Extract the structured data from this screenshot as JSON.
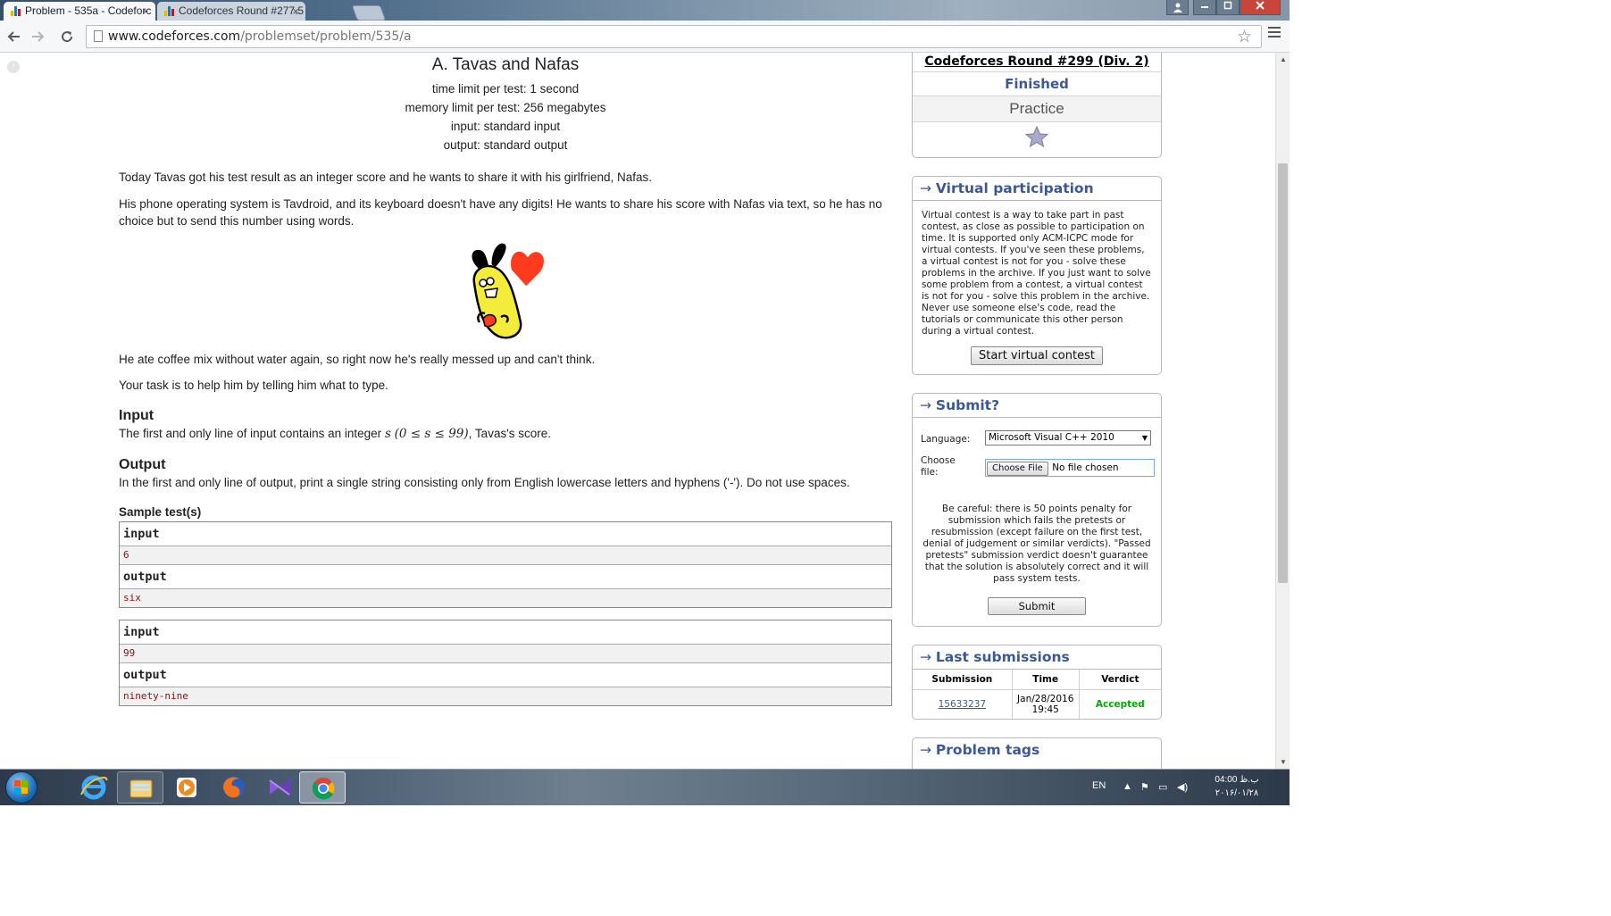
{
  "browser": {
    "tabs": [
      {
        "title": "Problem - 535a - Codeforc",
        "active": true
      },
      {
        "title": "Codeforces Round #277.5",
        "active": false
      }
    ],
    "url_host": "www.codeforces.com",
    "url_path": "/problemset/problem/535/a",
    "close_glyph": "×"
  },
  "problem": {
    "title": "A. Tavas and Nafas",
    "limits": [
      "time limit per test: 1 second",
      "memory limit per test: 256 megabytes",
      "input: standard input",
      "output: standard output"
    ],
    "statement": [
      "Today Tavas got his test result as an integer score and he wants to share it with his girlfriend, Nafas.",
      "His phone operating system is Tavdroid, and its keyboard doesn't have any digits! He wants to share his score with Nafas via text, so he has no choice but to send this number using words.",
      "He ate coffee mix without water again, so right now he's really messed up and can't think.",
      "Your task is to help him by telling him what to type."
    ],
    "input_title": "Input",
    "input_text_before": "The first and only line of input contains an integer ",
    "input_math_var": "s",
    "input_math_range": "(0 ≤ s ≤ 99)",
    "input_text_after": ", Tavas's score.",
    "output_title": "Output",
    "output_text": "In the first and only line of output, print a single string consisting only from English lowercase letters and hyphens ('-'). Do not use spaces.",
    "samples_title": "Sample test(s)",
    "samples": [
      {
        "input_label": "input",
        "input": "6",
        "output_label": "output",
        "output": "six"
      },
      {
        "input_label": "input",
        "input": "99",
        "output_label": "output",
        "output": "ninety-nine"
      }
    ]
  },
  "sidebar": {
    "contest_name": "Codeforces Round #299 (Div. 2)",
    "contest_status": "Finished",
    "contest_mode": "Practice",
    "virtual": {
      "title": "Virtual participation",
      "text": "Virtual contest is a way to take part in past contest, as close as possible to participation on time. It is supported only ACM-ICPC mode for virtual contests. If you've seen these problems, a virtual contest is not for you - solve these problems in the archive. If you just want to solve some problem from a contest, a virtual contest is not for you - solve this problem in the archive. Never use someone else's code, read the tutorials or communicate this other person during a virtual contest.",
      "button": "Start virtual contest"
    },
    "submit": {
      "title": "Submit?",
      "language_label": "Language:",
      "language_value": "Microsoft Visual C++ 2010",
      "file_label": "Choose file:",
      "file_button": "Choose File",
      "file_status": "No file chosen",
      "warning": "Be careful: there is 50 points penalty for submission which fails the pretests or resubmission (except failure on the first test, denial of judgement or similar verdicts). \"Passed pretests\" submission verdict doesn't guarantee that the solution is absolutely correct and it will pass system tests.",
      "button": "Submit"
    },
    "last_submissions": {
      "title": "Last submissions",
      "headers": [
        "Submission",
        "Time",
        "Verdict"
      ],
      "rows": [
        {
          "id": "15633237",
          "time": "Jan/28/2016 19:45",
          "verdict": "Accepted"
        }
      ]
    },
    "next_box_title": "Problem tags"
  },
  "taskbar": {
    "lang": "EN",
    "time": "04:00 ب.ظ",
    "date": "۲۰۱۶/۰۱/۲۸"
  },
  "colors": {
    "link": "#3b5998",
    "accepted": "#0a0",
    "sample_value": "#8a1010"
  }
}
